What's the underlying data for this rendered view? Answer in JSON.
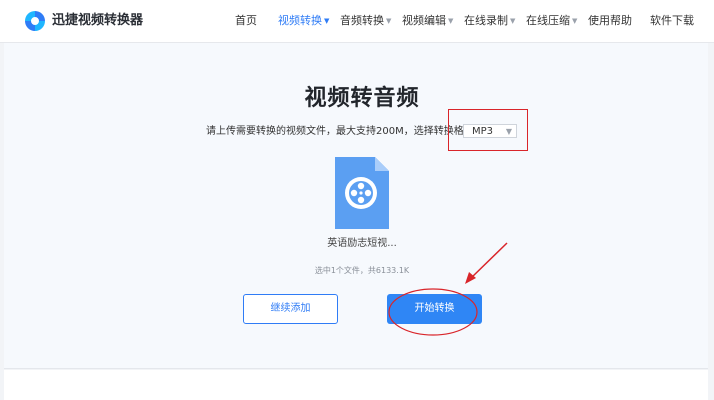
{
  "header": {
    "brand": "迅捷视频转换器",
    "nav": [
      {
        "label": "首页"
      },
      {
        "label": "视频转换",
        "active": true,
        "dropdown": true
      },
      {
        "label": "音频转换",
        "dropdown": true
      },
      {
        "label": "视频编辑",
        "dropdown": true
      },
      {
        "label": "在线录制",
        "dropdown": true
      },
      {
        "label": "在线压缩",
        "dropdown": true
      },
      {
        "label": "使用帮助"
      },
      {
        "label": "软件下载"
      }
    ]
  },
  "main": {
    "title": "视频转音频",
    "hint": "请上传需要转换的视频文件，最大支持200M，选择转换格式：",
    "format_select": {
      "value": "MP3"
    },
    "file": {
      "name": "英语励志短视..."
    },
    "count_text": "选中1个文件，共6133.1K",
    "continue_add_label": "继续添加",
    "start_label": "开始转换"
  },
  "colors": {
    "accent": "#2f7cf6",
    "annotation_red": "#d9252a",
    "file_icon": "#5b9ff2"
  }
}
